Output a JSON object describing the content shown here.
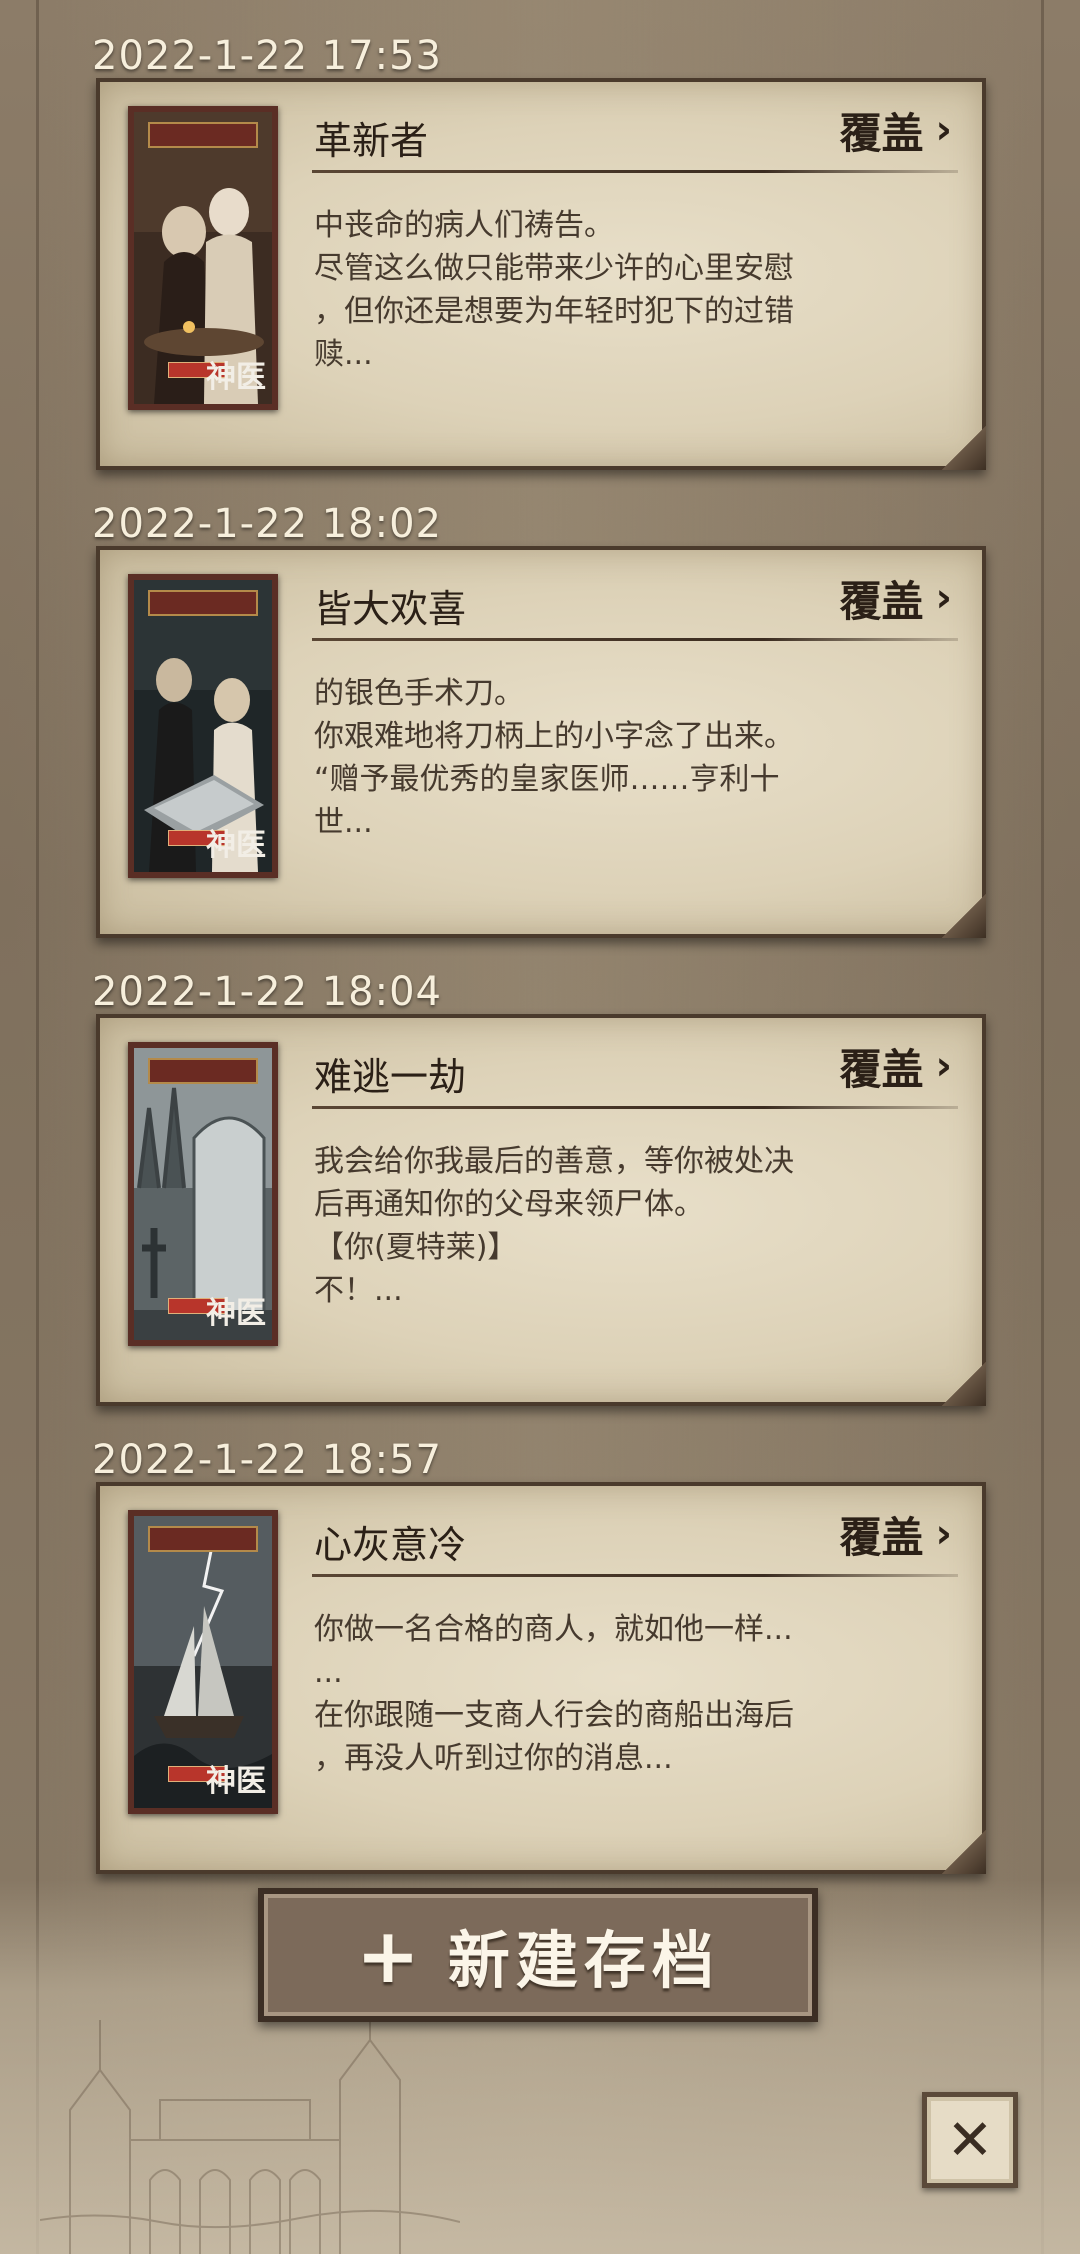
{
  "saves": [
    {
      "timestamp": "2022-1-22  17:53",
      "title": "革新者",
      "cover_label": "覆盖",
      "excerpt": [
        "中丧命的病人们祷告。",
        "尽管这么做只能带来少许的心里安慰",
        "，但你还是想要为年轻时犯下的过错",
        "赎..."
      ],
      "thumb_icon": "tavern-scene-thumbnail"
    },
    {
      "timestamp": "2022-1-22  18:02",
      "title": "皆大欢喜",
      "cover_label": "覆盖",
      "excerpt": [
        "的银色手术刀。",
        "你艰难地将刀柄上的小字念了出来。",
        "“赠予最优秀的皇家医师……亨利十",
        "世..."
      ],
      "thumb_icon": "operating-scene-thumbnail"
    },
    {
      "timestamp": "2022-1-22  18:04",
      "title": "难逃一劫",
      "cover_label": "覆盖",
      "excerpt": [
        "我会给你我最后的善意，等你被处决",
        "后再通知你的父母来领尸体。",
        "【你(夏特莱)】",
        "不！..."
      ],
      "thumb_icon": "graveyard-scene-thumbnail"
    },
    {
      "timestamp": "2022-1-22  18:57",
      "title": "心灰意冷",
      "cover_label": "覆盖",
      "excerpt": [
        "你做一名合格的商人，就如他一样...",
        "...",
        "在你跟随一支商人行会的商船出海后",
        "，再没人听到过你的消息..."
      ],
      "thumb_icon": "storm-ship-thumbnail"
    }
  ],
  "chevron": "›",
  "new_save": {
    "plus": "+",
    "label": "新建存档"
  },
  "close": {
    "icon": "close-icon",
    "glyph": "✕"
  }
}
